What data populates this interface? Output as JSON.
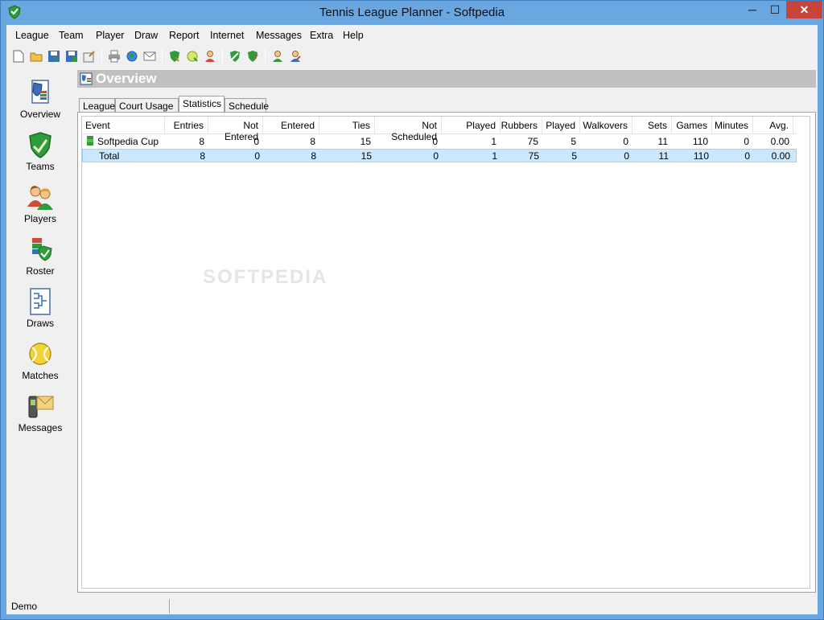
{
  "window": {
    "title": "Tennis League Planner - Softpedia",
    "min_glyph": "─",
    "max_glyph": "☐",
    "close_glyph": "✕"
  },
  "menu": [
    "League",
    "Team",
    "Player",
    "Draw",
    "Report",
    "Internet",
    "Messages",
    "Extra",
    "Help"
  ],
  "toolbar_icons": [
    "new-icon",
    "open-icon",
    "save-icon",
    "save-all-icon",
    "export-icon",
    "print-icon",
    "web-icon",
    "email-icon",
    "team-shield-icon",
    "ball-icon",
    "player-icon",
    "shield-green-icon",
    "shield-edit-icon",
    "player-add-icon",
    "player-edit-icon"
  ],
  "sidebar": [
    {
      "label": "Overview",
      "icon": "overview-icon"
    },
    {
      "label": "Teams",
      "icon": "shield-icon"
    },
    {
      "label": "Players",
      "icon": "players-icon"
    },
    {
      "label": "Roster",
      "icon": "roster-icon"
    },
    {
      "label": "Draws",
      "icon": "draws-icon"
    },
    {
      "label": "Matches",
      "icon": "tennis-ball-icon"
    },
    {
      "label": "Messages",
      "icon": "messages-icon"
    }
  ],
  "header": {
    "title": "Overview"
  },
  "tabs": [
    {
      "label": "League",
      "active": false
    },
    {
      "label": "Court Usage",
      "active": false
    },
    {
      "label": "Statistics",
      "active": true
    },
    {
      "label": "Schedule",
      "active": false
    }
  ],
  "table": {
    "columns": [
      "Event",
      "Entries",
      "Not Entered",
      "Entered",
      "Ties",
      "Not Scheduled",
      "Played",
      "Rubbers",
      "Played",
      "Walkovers",
      "Sets",
      "Games",
      "Minutes",
      "Avg."
    ],
    "rows": [
      {
        "cells": [
          "Softpedia Cup",
          "8",
          "0",
          "8",
          "15",
          "0",
          "1",
          "75",
          "5",
          "0",
          "11",
          "110",
          "0",
          "0.00"
        ],
        "selected": false,
        "icon": "event-icon"
      },
      {
        "cells": [
          "Total",
          "8",
          "0",
          "8",
          "15",
          "0",
          "1",
          "75",
          "5",
          "0",
          "11",
          "110",
          "0",
          "0.00"
        ],
        "selected": true
      }
    ]
  },
  "watermark": "SOFTPEDIA",
  "status": {
    "text": "Demo"
  },
  "colors": {
    "titlebar": "#6aa6e0",
    "close": "#c7443b",
    "header_bar": "#c0c0c0",
    "selection": "#cce8ff"
  }
}
